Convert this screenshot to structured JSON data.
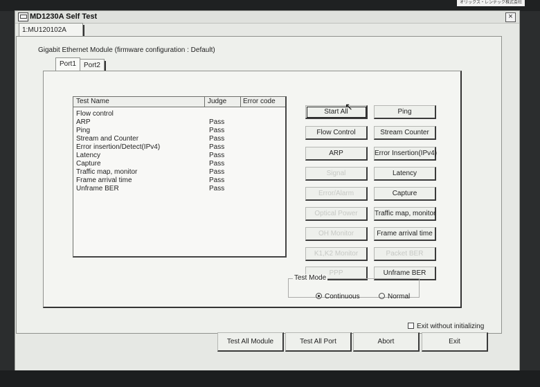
{
  "corner_label": "オリックス・レンテック株式会社",
  "window": {
    "title": "MD1230A Self Test",
    "close_glyph": "×"
  },
  "module_tab": "1:MU120102A",
  "module_label": "Gigabit Ethernet Module (firmware configuration : Default)",
  "port_tabs": [
    "Port1",
    "Port2"
  ],
  "table": {
    "headers": [
      "Test Name",
      "Judge",
      "Error code"
    ],
    "rows": [
      {
        "name": "Flow control",
        "judge": ""
      },
      {
        "name": "ARP",
        "judge": "Pass"
      },
      {
        "name": "Ping",
        "judge": "Pass"
      },
      {
        "name": "Stream and Counter",
        "judge": "Pass"
      },
      {
        "name": "Error insertion/Detect(IPv4)",
        "judge": "Pass"
      },
      {
        "name": "Latency",
        "judge": "Pass"
      },
      {
        "name": "Capture",
        "judge": "Pass"
      },
      {
        "name": "Traffic map, monitor",
        "judge": "Pass"
      },
      {
        "name": "Frame arrival time",
        "judge": "Pass"
      },
      {
        "name": "Unframe BER",
        "judge": "Pass"
      }
    ]
  },
  "buttons": [
    {
      "label": "Start All",
      "enabled": true,
      "focused": true
    },
    {
      "label": "Ping",
      "enabled": true
    },
    {
      "label": "Flow Control",
      "enabled": true
    },
    {
      "label": "Stream Counter",
      "enabled": true
    },
    {
      "label": "ARP",
      "enabled": true
    },
    {
      "label": "Error Insertion(IPv4)",
      "enabled": true
    },
    {
      "label": "Signal",
      "enabled": false
    },
    {
      "label": "Latency",
      "enabled": true
    },
    {
      "label": "Error/Alarm",
      "enabled": false
    },
    {
      "label": "Capture",
      "enabled": true
    },
    {
      "label": "Optical Power",
      "enabled": false
    },
    {
      "label": "Traffic map, monitor",
      "enabled": true
    },
    {
      "label": "OH Monitor",
      "enabled": false
    },
    {
      "label": "Frame arrival time",
      "enabled": true
    },
    {
      "label": "K1,K2 Monitor",
      "enabled": false
    },
    {
      "label": "Packet BER",
      "enabled": false
    },
    {
      "label": "PPP",
      "enabled": false
    },
    {
      "label": "Unframe BER",
      "enabled": true
    }
  ],
  "test_mode": {
    "label": "Test Mode",
    "options": [
      "Continuous",
      "Normal"
    ],
    "selected": "Continuous"
  },
  "exit_without_initializing": {
    "label": "Exit without initializing",
    "checked": false
  },
  "bottom_buttons": [
    "Test All Module",
    "Test All Port",
    "Abort",
    "Exit"
  ]
}
